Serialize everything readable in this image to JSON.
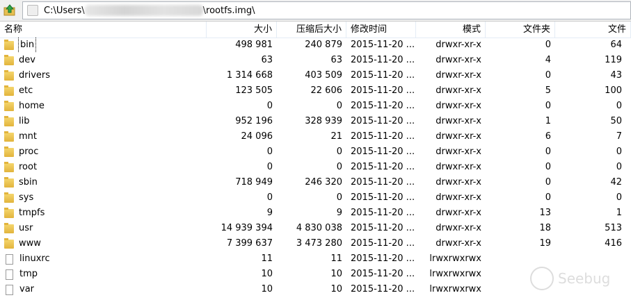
{
  "address": {
    "prefix": "C:\\Users\\",
    "suffix": "\\rootfs.img\\"
  },
  "columns": [
    "名称",
    "大小",
    "压缩后大小",
    "修改时间",
    "模式",
    "文件夹",
    "文件"
  ],
  "rows": [
    {
      "type": "folder",
      "name": "bin",
      "size": "498 981",
      "packed": "240 879",
      "mtime": "2015-11-20 ...",
      "mode": "drwxr-xr-x",
      "folders": "0",
      "files": "64"
    },
    {
      "type": "folder",
      "name": "dev",
      "size": "63",
      "packed": "63",
      "mtime": "2015-11-20 ...",
      "mode": "drwxr-xr-x",
      "folders": "4",
      "files": "119"
    },
    {
      "type": "folder",
      "name": "drivers",
      "size": "1 314 668",
      "packed": "403 509",
      "mtime": "2015-11-20 ...",
      "mode": "drwxr-xr-x",
      "folders": "0",
      "files": "43"
    },
    {
      "type": "folder",
      "name": "etc",
      "size": "123 505",
      "packed": "22 606",
      "mtime": "2015-11-20 ...",
      "mode": "drwxr-xr-x",
      "folders": "5",
      "files": "100"
    },
    {
      "type": "folder",
      "name": "home",
      "size": "0",
      "packed": "0",
      "mtime": "2015-11-20 ...",
      "mode": "drwxr-xr-x",
      "folders": "0",
      "files": "0"
    },
    {
      "type": "folder",
      "name": "lib",
      "size": "952 196",
      "packed": "328 939",
      "mtime": "2015-11-20 ...",
      "mode": "drwxr-xr-x",
      "folders": "1",
      "files": "50"
    },
    {
      "type": "folder",
      "name": "mnt",
      "size": "24 096",
      "packed": "21",
      "mtime": "2015-11-20 ...",
      "mode": "drwxr-xr-x",
      "folders": "6",
      "files": "7"
    },
    {
      "type": "folder",
      "name": "proc",
      "size": "0",
      "packed": "0",
      "mtime": "2015-11-20 ...",
      "mode": "drwxr-xr-x",
      "folders": "0",
      "files": "0"
    },
    {
      "type": "folder",
      "name": "root",
      "size": "0",
      "packed": "0",
      "mtime": "2015-11-20 ...",
      "mode": "drwxr-xr-x",
      "folders": "0",
      "files": "0"
    },
    {
      "type": "folder",
      "name": "sbin",
      "size": "718 949",
      "packed": "246 320",
      "mtime": "2015-11-20 ...",
      "mode": "drwxr-xr-x",
      "folders": "0",
      "files": "42"
    },
    {
      "type": "folder",
      "name": "sys",
      "size": "0",
      "packed": "0",
      "mtime": "2015-11-20 ...",
      "mode": "drwxr-xr-x",
      "folders": "0",
      "files": "0"
    },
    {
      "type": "folder",
      "name": "tmpfs",
      "size": "9",
      "packed": "9",
      "mtime": "2015-11-20 ...",
      "mode": "drwxr-xr-x",
      "folders": "13",
      "files": "1"
    },
    {
      "type": "folder",
      "name": "usr",
      "size": "14 939 394",
      "packed": "4 830 038",
      "mtime": "2015-11-20 ...",
      "mode": "drwxr-xr-x",
      "folders": "18",
      "files": "513"
    },
    {
      "type": "folder",
      "name": "www",
      "size": "7 399 637",
      "packed": "3 473 280",
      "mtime": "2015-11-20 ...",
      "mode": "drwxr-xr-x",
      "folders": "19",
      "files": "416"
    },
    {
      "type": "file",
      "name": "linuxrc",
      "size": "11",
      "packed": "11",
      "mtime": "2015-11-20 ...",
      "mode": "lrwxrwxrwx",
      "folders": "",
      "files": ""
    },
    {
      "type": "file",
      "name": "tmp",
      "size": "10",
      "packed": "10",
      "mtime": "2015-11-20 ...",
      "mode": "lrwxrwxrwx",
      "folders": "",
      "files": ""
    },
    {
      "type": "file",
      "name": "var",
      "size": "10",
      "packed": "10",
      "mtime": "2015-11-20 ...",
      "mode": "lrwxrwxrwx",
      "folders": "",
      "files": ""
    }
  ],
  "watermark": "Seebug"
}
